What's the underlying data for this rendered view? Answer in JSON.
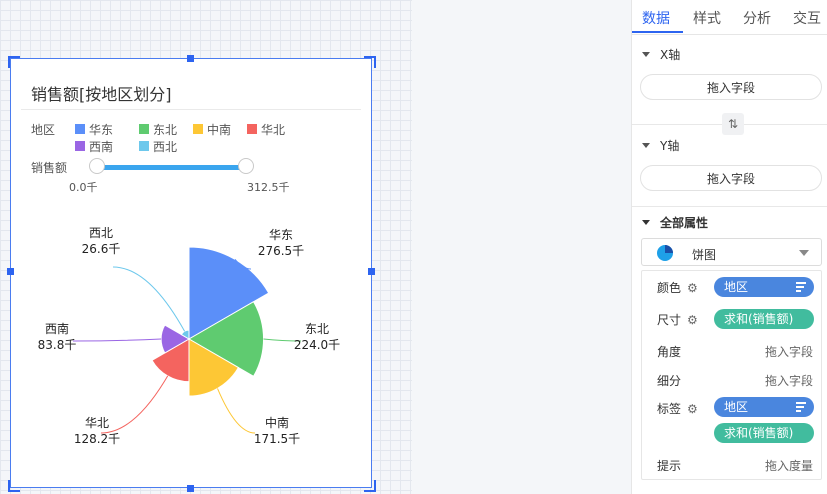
{
  "chart": {
    "title": "销售额[按地区划分]",
    "legend_label": "地区",
    "slider": {
      "label": "销售额",
      "min_label": "0.0千",
      "max_label": "312.5千",
      "low": 0.0,
      "high": 312.5,
      "range_max": 312.5
    }
  },
  "chart_data": {
    "type": "pie",
    "title": "销售额[按地区划分]",
    "categories": [
      "华东",
      "东北",
      "中南",
      "华北",
      "西南",
      "西北"
    ],
    "values": [
      276.5,
      224.0,
      171.5,
      128.2,
      83.8,
      26.6
    ],
    "value_labels": [
      "276.5千",
      "224.0千",
      "171.5千",
      "128.2千",
      "83.8千",
      "26.6千"
    ],
    "colors": [
      "#5b8ff9",
      "#5fcb70",
      "#fdc735",
      "#f4645f",
      "#9a66e4",
      "#6dc8ec"
    ],
    "legend_placement": "top-left",
    "grid": false
  },
  "panel": {
    "tabs": [
      "数据",
      "样式",
      "分析",
      "交互"
    ],
    "x_axis": {
      "title": "X轴",
      "placeholder": "拖入字段"
    },
    "y_axis": {
      "title": "Y轴",
      "placeholder": "拖入字段"
    },
    "swap_icon": "⇅",
    "all_props_title": "全部属性",
    "chart_type": "饼图",
    "props": {
      "color": {
        "label": "颜色",
        "field": "地区"
      },
      "size": {
        "label": "尺寸",
        "field": "求和(销售额)"
      },
      "angle": {
        "label": "角度",
        "hint": "拖入字段"
      },
      "detail": {
        "label": "细分",
        "hint": "拖入字段"
      },
      "label": {
        "label": "标签",
        "field1": "地区",
        "field2": "求和(销售额)"
      },
      "tooltip": {
        "label": "提示",
        "hint": "拖入度量"
      }
    }
  }
}
